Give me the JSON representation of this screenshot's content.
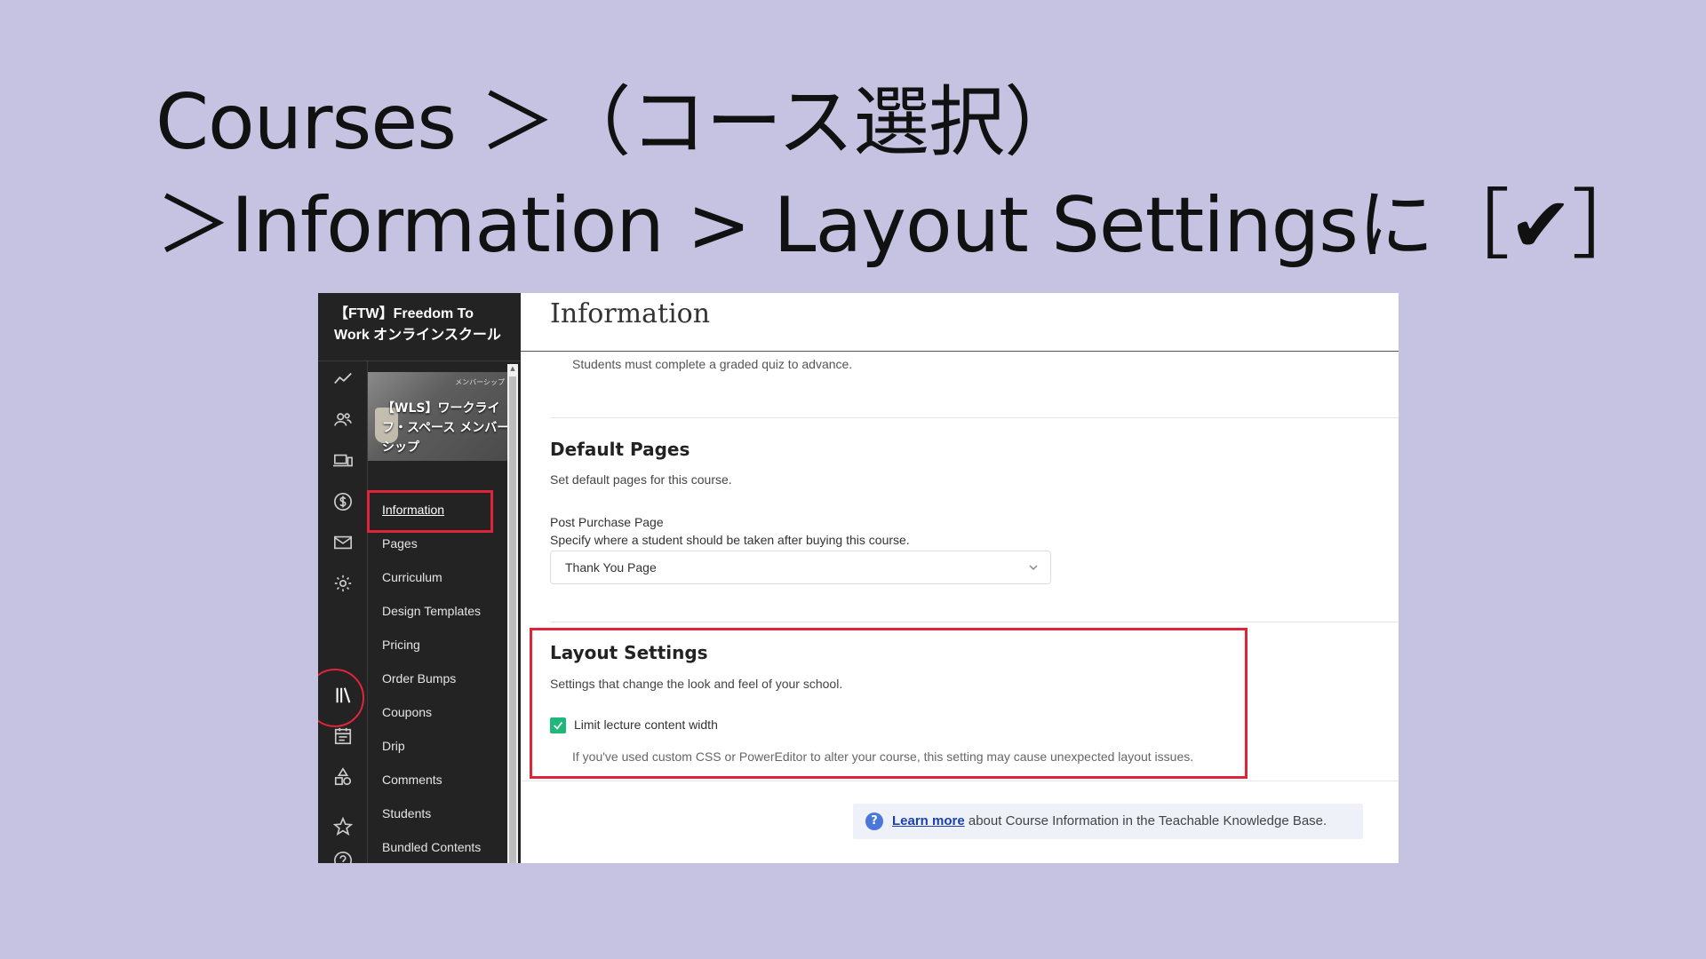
{
  "slide": {
    "title_line1": "Courses ＞（コース選択）",
    "title_line2": "＞Information > Layout Settingsに［✔］"
  },
  "sidebar": {
    "school_name": "【FTW】Freedom To Work オンラインスクール",
    "icons": [
      "analytics-icon",
      "users-icon",
      "devices-icon",
      "dollar-icon",
      "mail-icon",
      "gear-icon",
      "library-icon",
      "calendar-icon",
      "shapes-icon",
      "star-icon",
      "help-circle-icon"
    ],
    "course_thumbnail": {
      "tiny_text": "メンバーシップ",
      "name": "【WLS】ワークライフ・スペース メンバーシップ"
    },
    "menu": [
      {
        "label": "Information",
        "active": true
      },
      {
        "label": "Pages"
      },
      {
        "label": "Curriculum"
      },
      {
        "label": "Design Templates"
      },
      {
        "label": "Pricing"
      },
      {
        "label": "Order Bumps"
      },
      {
        "label": "Coupons"
      },
      {
        "label": "Drip"
      },
      {
        "label": "Comments"
      },
      {
        "label": "Students"
      },
      {
        "label": "Bundled Contents"
      }
    ]
  },
  "main": {
    "page_title": "Information",
    "quiz_note": "Students must complete a graded quiz to advance.",
    "default_pages": {
      "heading": "Default Pages",
      "description": "Set default pages for this course.",
      "post_purchase_label": "Post Purchase Page",
      "post_purchase_help": "Specify where a student should be taken after buying this course.",
      "post_purchase_value": "Thank You Page"
    },
    "layout_settings": {
      "heading": "Layout Settings",
      "description": "Settings that change the look and feel of your school.",
      "checkbox_label": "Limit lecture content width",
      "checkbox_checked": true,
      "warning": "If you've used custom CSS or PowerEditor to alter your course, this setting may cause unexpected layout issues."
    },
    "help": {
      "link_text": "Learn more",
      "rest_text": " about Course Information in the Teachable Knowledge Base."
    }
  },
  "colors": {
    "background": "#c6c2e1",
    "sidebar": "#232323",
    "highlight": "#e0243a",
    "checkbox": "#1fb87a"
  }
}
